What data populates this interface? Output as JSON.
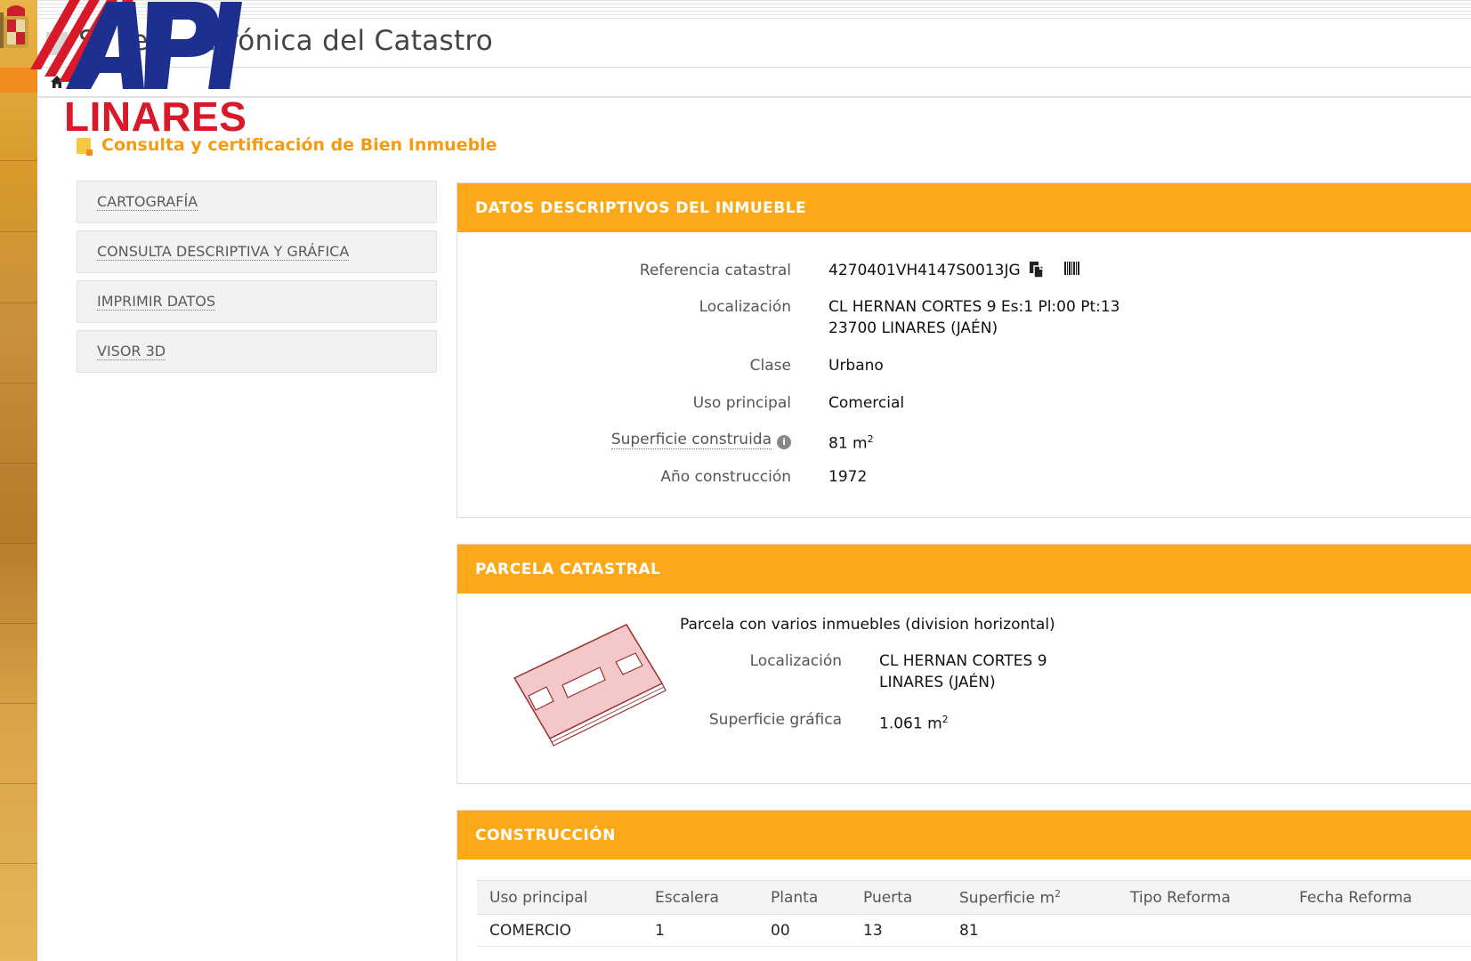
{
  "header": {
    "site_title": "Sede Electrónica del Catastro",
    "logo_top": "API",
    "logo_bottom": "LINARES"
  },
  "page_heading": "Consulta y certificación de Bien Inmueble",
  "menu": [
    {
      "label": "CARTOGRAFÍA"
    },
    {
      "label": "CONSULTA DESCRIPTIVA Y GRÁFICA"
    },
    {
      "label": "IMPRIMIR DATOS"
    },
    {
      "label": "VISOR 3D"
    }
  ],
  "datos": {
    "title": "DATOS DESCRIPTIVOS DEL INMUEBLE",
    "ref_label": "Referencia catastral",
    "ref_value": "4270401VH4147S0013JG",
    "loc_label": "Localización",
    "loc_line1": "CL HERNAN CORTES 9 Es:1 Pl:00 Pt:13",
    "loc_line2": "23700 LINARES (JAÉN)",
    "clase_label": "Clase",
    "clase_value": "Urbano",
    "uso_label": "Uso principal",
    "uso_value": "Comercial",
    "sup_label": "Superficie construida",
    "sup_value": "81 m",
    "sup_exp": "2",
    "anio_label": "Año construcción",
    "anio_value": "1972"
  },
  "parcela": {
    "title": "PARCELA CATASTRAL",
    "desc": "Parcela con varios inmuebles (division horizontal)",
    "loc_label": "Localización",
    "loc_line1": "CL HERNAN CORTES 9",
    "loc_line2": "LINARES (JAÉN)",
    "sup_label": "Superficie gráfica",
    "sup_value": "1.061 m",
    "sup_exp": "2"
  },
  "construccion": {
    "title": "CONSTRUCCIÓN",
    "headers": [
      "Uso principal",
      "Escalera",
      "Planta",
      "Puerta",
      "Superficie m",
      "Tipo Reforma",
      "Fecha Reforma"
    ],
    "header_exp": "2",
    "rows": [
      [
        "COMERCIO",
        "1",
        "00",
        "13",
        "81",
        "",
        ""
      ]
    ]
  },
  "colors": {
    "accent": "#fba919",
    "heading": "#f39c12",
    "logo_blue": "#1d2f8f",
    "logo_red": "#d7192a"
  },
  "icons": [
    "home-icon",
    "copy-icon",
    "barcode-icon",
    "info-icon",
    "emblem-icon"
  ]
}
